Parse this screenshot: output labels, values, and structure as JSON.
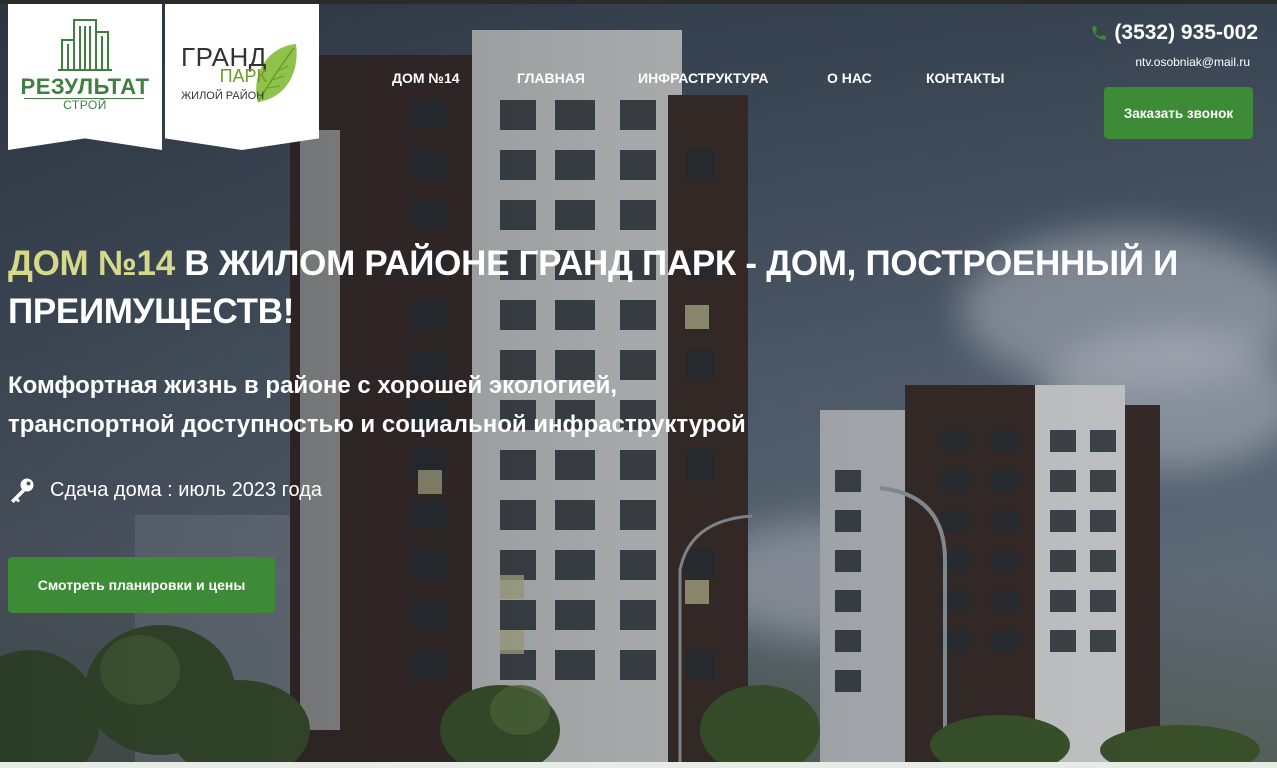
{
  "logos": {
    "left": {
      "name": "РЕЗУЛЬТАТ",
      "sub": "СТРОЙ"
    },
    "right": {
      "line1": "ГРАНД",
      "line2": "ПАРК",
      "line3": "ЖИЛОЙ РАЙОН"
    }
  },
  "nav": {
    "items": [
      {
        "label": "ДОМ №14"
      },
      {
        "label": "ГЛАВНАЯ"
      },
      {
        "label": "ИНФРАСТРУКТУРА"
      },
      {
        "label": "О НАС"
      },
      {
        "label": "КОНТАКТЫ"
      }
    ]
  },
  "contact": {
    "phone": "(3532) 935-002",
    "email": "ntv.osobniak@mail.ru",
    "call_button": "Заказать звонок"
  },
  "hero": {
    "headline_accent": "ДОМ №14",
    "headline_rest": " В ЖИЛОМ РАЙОНЕ ГРАНД ПАРК - ДОМ, ПОСТРОЕННЫЙ И ПРЕИМУЩЕСТВ!",
    "subline_1": "Комфортная жизнь в районе с хорошей экологией,",
    "subline_2": "транспортной доступностью и социальной инфраструктурой",
    "handover": "Сдача дома : июль 2023 года",
    "plans_button": "Смотреть планировки и цены"
  },
  "colors": {
    "accent_green": "#3d8a37",
    "headline_accent": "#d6d88a",
    "logo_green": "#3f7f3f"
  },
  "icons": {
    "phone": "phone-icon",
    "key": "key-icon"
  }
}
